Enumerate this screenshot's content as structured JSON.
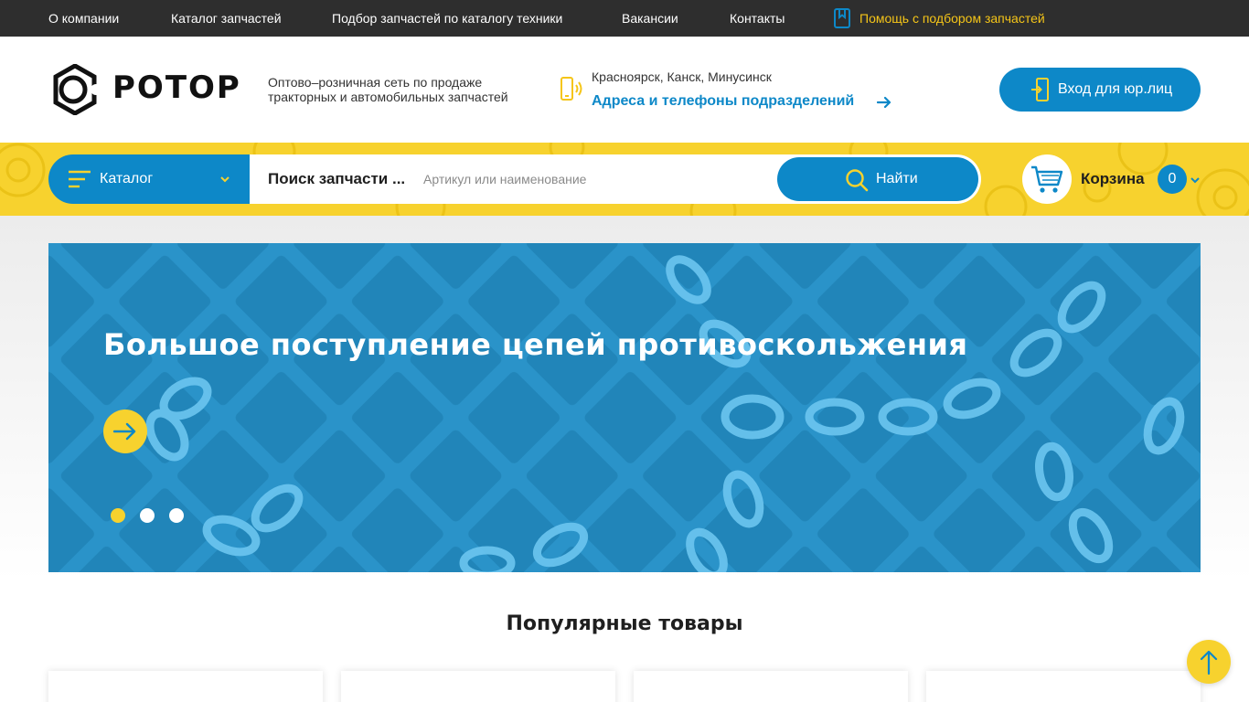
{
  "topnav": {
    "items": [
      {
        "label": "О компании"
      },
      {
        "label": "Каталог запчастей"
      },
      {
        "label": "Подбор запчастей по каталогу техники"
      },
      {
        "label": "Вакансии"
      },
      {
        "label": "Контакты"
      }
    ],
    "help_label": "Помощь с подбором запчастей"
  },
  "header": {
    "logo_text": "РОТОР",
    "tagline": "Оптово–розничная сеть по продаже тракторных и автомобильных запчастей",
    "cities": "Красноярск, Канск, Минусинск",
    "addresses_link": "Адреса и телефоны подразделений",
    "login_label": "Вход для юр.лиц"
  },
  "search": {
    "catalog_label": "Каталог",
    "mode_label": "Поиск запчасти ...",
    "placeholder": "Артикул или наименование",
    "value": "",
    "button_label": "Найти"
  },
  "cart": {
    "label": "Корзина",
    "count": "0"
  },
  "banner": {
    "title": "Большое поступление цепей противоскольжения",
    "slides_total": 3,
    "active_slide": 1
  },
  "popular": {
    "title": "Популярные товары"
  },
  "colors": {
    "brand_blue": "#0d88c8",
    "brand_yellow": "#f7d22e",
    "topbar_dark": "#2e2e2e"
  },
  "icons": [
    "bookmark-icon",
    "phone-icon",
    "arrow-right-icon",
    "login-door-icon",
    "burger-menu-icon",
    "chevron-down-icon",
    "search-icon",
    "cart-icon",
    "arrow-up-icon"
  ]
}
